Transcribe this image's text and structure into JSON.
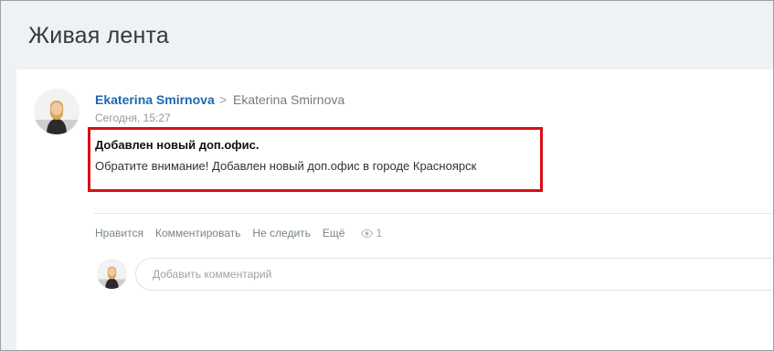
{
  "page": {
    "title": "Живая лента"
  },
  "post": {
    "author": "Ekaterina Smirnova",
    "recipient": "Ekaterina Smirnova",
    "separator": ">",
    "timestamp": "Сегодня, 15:27",
    "title": "Добавлен новый доп.офис.",
    "text": "Обратите внимание! Добавлен новый доп.офис в городе Красноярск",
    "highlight_color": "#d51215"
  },
  "actions": {
    "like": "Нравится",
    "comment": "Комментировать",
    "unfollow": "Не следить",
    "more": "Ещё",
    "views_icon": "eye-icon",
    "views": "1"
  },
  "comment": {
    "placeholder": "Добавить комментарий"
  },
  "colors": {
    "link": "#2067b0",
    "background": "#eef2f4"
  }
}
